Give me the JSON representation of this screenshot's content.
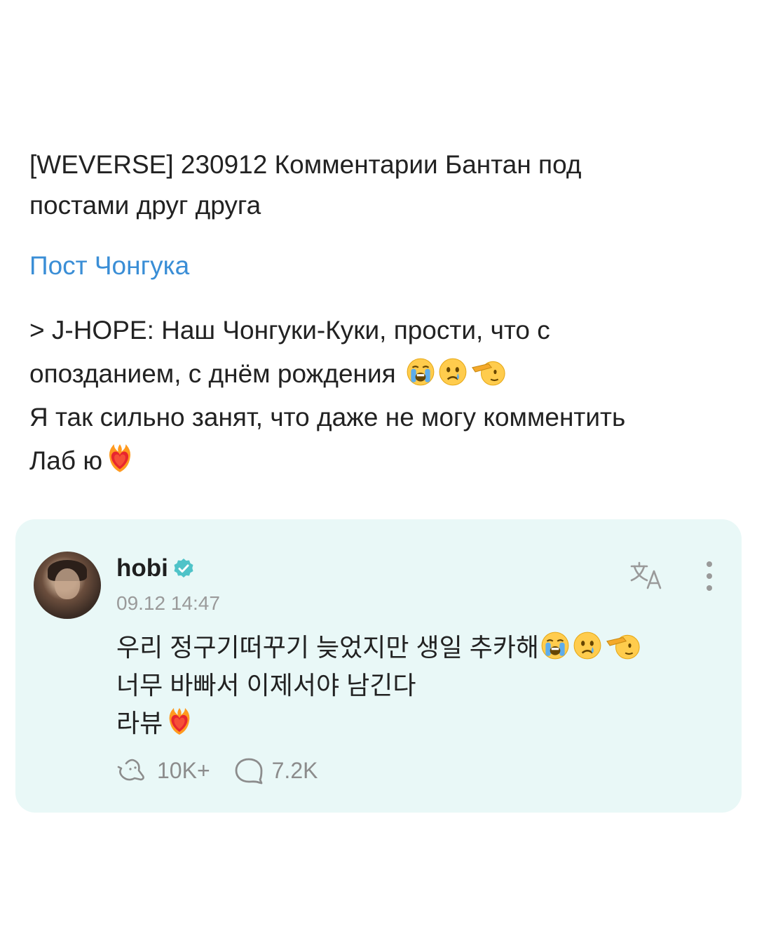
{
  "post": {
    "title_line1": "[WEVERSE] 230912 Комментарии Бантан под",
    "title_line2": "постами друг друга",
    "link_text": "Пост Чонгука",
    "quote_line1": "> J-HOPE: Наш Чонгуки-Куки, прости, что с",
    "quote_line2": "опозданием, с днём рождения",
    "quote_line3": "Я так сильно занят, что даже не могу комментить",
    "quote_line4": "Лаб ю",
    "emojis": [
      "loudly-crying-face",
      "crying-face",
      "saluting-face",
      "heart-on-fire"
    ]
  },
  "comment_card": {
    "username": "hobi",
    "verified": true,
    "timestamp": "09.12 14:47",
    "text_line1": "우리 정구기떠꾸기 늦었지만 생일 추카해",
    "text_line2": "너무 바빠서 이제서야 남긴다",
    "text_line3": "라뷰",
    "likes_count": "10K+",
    "replies_count": "7.2K",
    "icons": [
      "avatar",
      "verified-badge-icon",
      "translate-icon",
      "more-options-icon",
      "like-icon",
      "reply-icon"
    ]
  },
  "colors": {
    "link": "#3a8ed6",
    "card_background": "#e9f8f7",
    "verified_badge": "#4fc3c8",
    "muted_text": "#9a9a9a"
  }
}
